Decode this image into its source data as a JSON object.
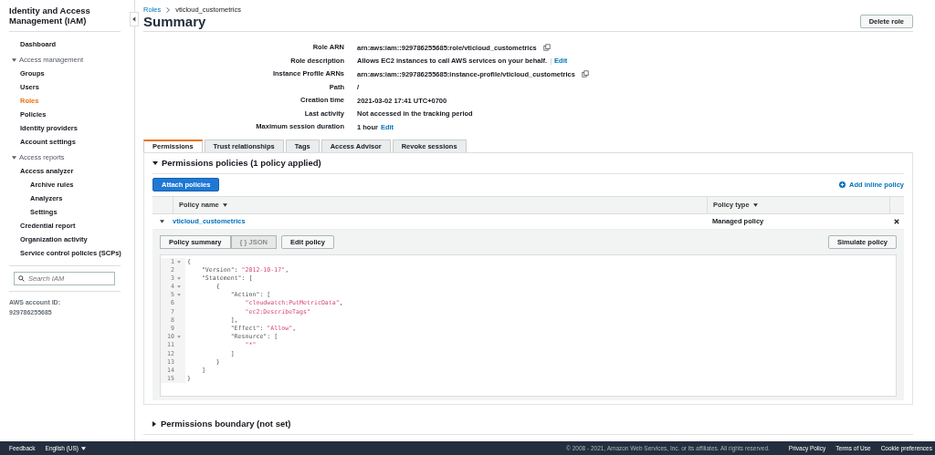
{
  "sidebar": {
    "title": "Identity and Access Management (IAM)",
    "items": [
      {
        "label": "Dashboard",
        "kind": "link",
        "selected": false
      },
      {
        "label": "Access management",
        "kind": "group",
        "expanded": true,
        "children": [
          {
            "label": "Groups",
            "kind": "link",
            "selected": false
          },
          {
            "label": "Users",
            "kind": "link",
            "selected": false
          },
          {
            "label": "Roles",
            "kind": "link",
            "selected": true
          },
          {
            "label": "Policies",
            "kind": "link",
            "selected": false
          },
          {
            "label": "Identity providers",
            "kind": "link",
            "selected": false
          },
          {
            "label": "Account settings",
            "kind": "link",
            "selected": false
          }
        ]
      },
      {
        "label": "Access reports",
        "kind": "group",
        "expanded": true,
        "children": [
          {
            "label": "Access analyzer",
            "kind": "link",
            "selected": false,
            "children": [
              {
                "label": "Archive rules",
                "kind": "link",
                "selected": false
              },
              {
                "label": "Analyzers",
                "kind": "link",
                "selected": false
              },
              {
                "label": "Settings",
                "kind": "link",
                "selected": false
              }
            ]
          },
          {
            "label": "Credential report",
            "kind": "link",
            "selected": false
          },
          {
            "label": "Organization activity",
            "kind": "link",
            "selected": false
          },
          {
            "label": "Service control policies (SCPs)",
            "kind": "link",
            "selected": false
          }
        ]
      }
    ],
    "search": {
      "placeholder": "Search IAM"
    },
    "account_label": "AWS account ID:",
    "account_id": "929786255685"
  },
  "breadcrumb": [
    {
      "label": "Roles",
      "kind": "link"
    },
    {
      "label": "vticloud_custometrics",
      "kind": "current"
    }
  ],
  "title": "Summary",
  "delete_button": "Delete role",
  "details": [
    {
      "label": "Role ARN",
      "value": "arn:aws:iam::929786255685:role/vticloud_custometrics",
      "copy": true
    },
    {
      "label": "Role description",
      "value": "Allows EC2 instances to call AWS services on your behalf.",
      "separator": "|",
      "link": "Edit"
    },
    {
      "label": "Instance Profile ARNs",
      "value": "arn:aws:iam::929786255685:instance-profile/vticloud_custometrics",
      "copy": true
    },
    {
      "label": "Path",
      "value": "/"
    },
    {
      "label": "Creation time",
      "value": "2021-03-02 17:41 UTC+0700"
    },
    {
      "label": "Last activity",
      "value": "Not accessed in the tracking period"
    },
    {
      "label": "Maximum session duration",
      "value": "1 hour",
      "link": "Edit"
    }
  ],
  "tabs": [
    {
      "label": "Permissions",
      "selected": true
    },
    {
      "label": "Trust relationships",
      "selected": false
    },
    {
      "label": "Tags",
      "selected": false
    },
    {
      "label": "Access Advisor",
      "selected": false
    },
    {
      "label": "Revoke sessions",
      "selected": false
    }
  ],
  "permissions": {
    "title": "Permissions policies (1 policy applied)",
    "expanded": true,
    "attach_button": "Attach policies",
    "add_inline": "Add inline policy",
    "columns": [
      "Policy name",
      "Policy type"
    ],
    "rows": [
      {
        "name": "vticloud_custometrics",
        "type": "Managed policy",
        "expanded": true
      }
    ],
    "view_toggle": [
      {
        "label": "Policy summary",
        "selected": false
      },
      {
        "label": "{ } JSON",
        "selected": true
      }
    ],
    "edit_button": "Edit policy",
    "simulate_button": "Simulate policy",
    "code": [
      {
        "number": "1",
        "fold": true,
        "tokens": [
          {
            "kind": "plain",
            "text": "{"
          }
        ]
      },
      {
        "number": "2",
        "tokens": [
          {
            "kind": "plain",
            "text": "    \"Version\": "
          },
          {
            "kind": "string",
            "text": "\"2012-10-17\""
          },
          {
            "kind": "plain",
            "text": ","
          }
        ]
      },
      {
        "number": "3",
        "fold": true,
        "tokens": [
          {
            "kind": "plain",
            "text": "    \"Statement\": ["
          }
        ]
      },
      {
        "number": "4",
        "fold": true,
        "tokens": [
          {
            "kind": "plain",
            "text": "        {"
          }
        ]
      },
      {
        "number": "5",
        "fold": true,
        "tokens": [
          {
            "kind": "plain",
            "text": "            \"Action\": ["
          }
        ]
      },
      {
        "number": "6",
        "tokens": [
          {
            "kind": "string",
            "text": "                \"cloudwatch:PutMetricData\""
          },
          {
            "kind": "plain",
            "text": ","
          }
        ]
      },
      {
        "number": "7",
        "tokens": [
          {
            "kind": "string",
            "text": "                \"ec2:DescribeTags\""
          }
        ]
      },
      {
        "number": "8",
        "tokens": [
          {
            "kind": "plain",
            "text": "            ],"
          }
        ]
      },
      {
        "number": "9",
        "tokens": [
          {
            "kind": "plain",
            "text": "            \"Effect\": "
          },
          {
            "kind": "string",
            "text": "\"Allow\""
          },
          {
            "kind": "plain",
            "text": ","
          }
        ]
      },
      {
        "number": "10",
        "fold": true,
        "tokens": [
          {
            "kind": "plain",
            "text": "            \"Resource\": ["
          }
        ]
      },
      {
        "number": "11",
        "tokens": [
          {
            "kind": "string",
            "text": "                \"*\""
          }
        ]
      },
      {
        "number": "12",
        "tokens": [
          {
            "kind": "plain",
            "text": "            ]"
          }
        ]
      },
      {
        "number": "13",
        "tokens": [
          {
            "kind": "plain",
            "text": "        }"
          }
        ]
      },
      {
        "number": "14",
        "tokens": [
          {
            "kind": "plain",
            "text": "    ]"
          }
        ]
      },
      {
        "number": "15",
        "tokens": [
          {
            "kind": "plain",
            "text": "}"
          }
        ]
      }
    ]
  },
  "boundary": {
    "title": "Permissions boundary (not set)",
    "expanded": false
  },
  "footer": {
    "left": [
      {
        "label": "Feedback"
      },
      {
        "label": "English (US)",
        "dropdown": true
      }
    ],
    "copyright": "© 2008 - 2021, Amazon Web Services, Inc. or its affiliates. All rights reserved.",
    "links": [
      "Privacy Policy",
      "Terms of Use",
      "Cookie preferences"
    ]
  }
}
